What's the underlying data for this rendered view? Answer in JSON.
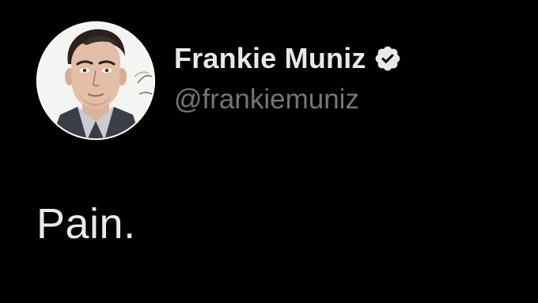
{
  "tweet": {
    "author": {
      "display_name": "Frankie Muniz",
      "handle": "@frankiemuniz",
      "verified": true,
      "avatar_icon": "illustrated-portrait",
      "verified_icon": "verified-badge-icon"
    },
    "text": "Pain."
  },
  "colors": {
    "background": "#000000",
    "name": "#e7e9ea",
    "handle": "#71767b",
    "text": "#e7e9ea",
    "badge": "#e7e9ea"
  }
}
